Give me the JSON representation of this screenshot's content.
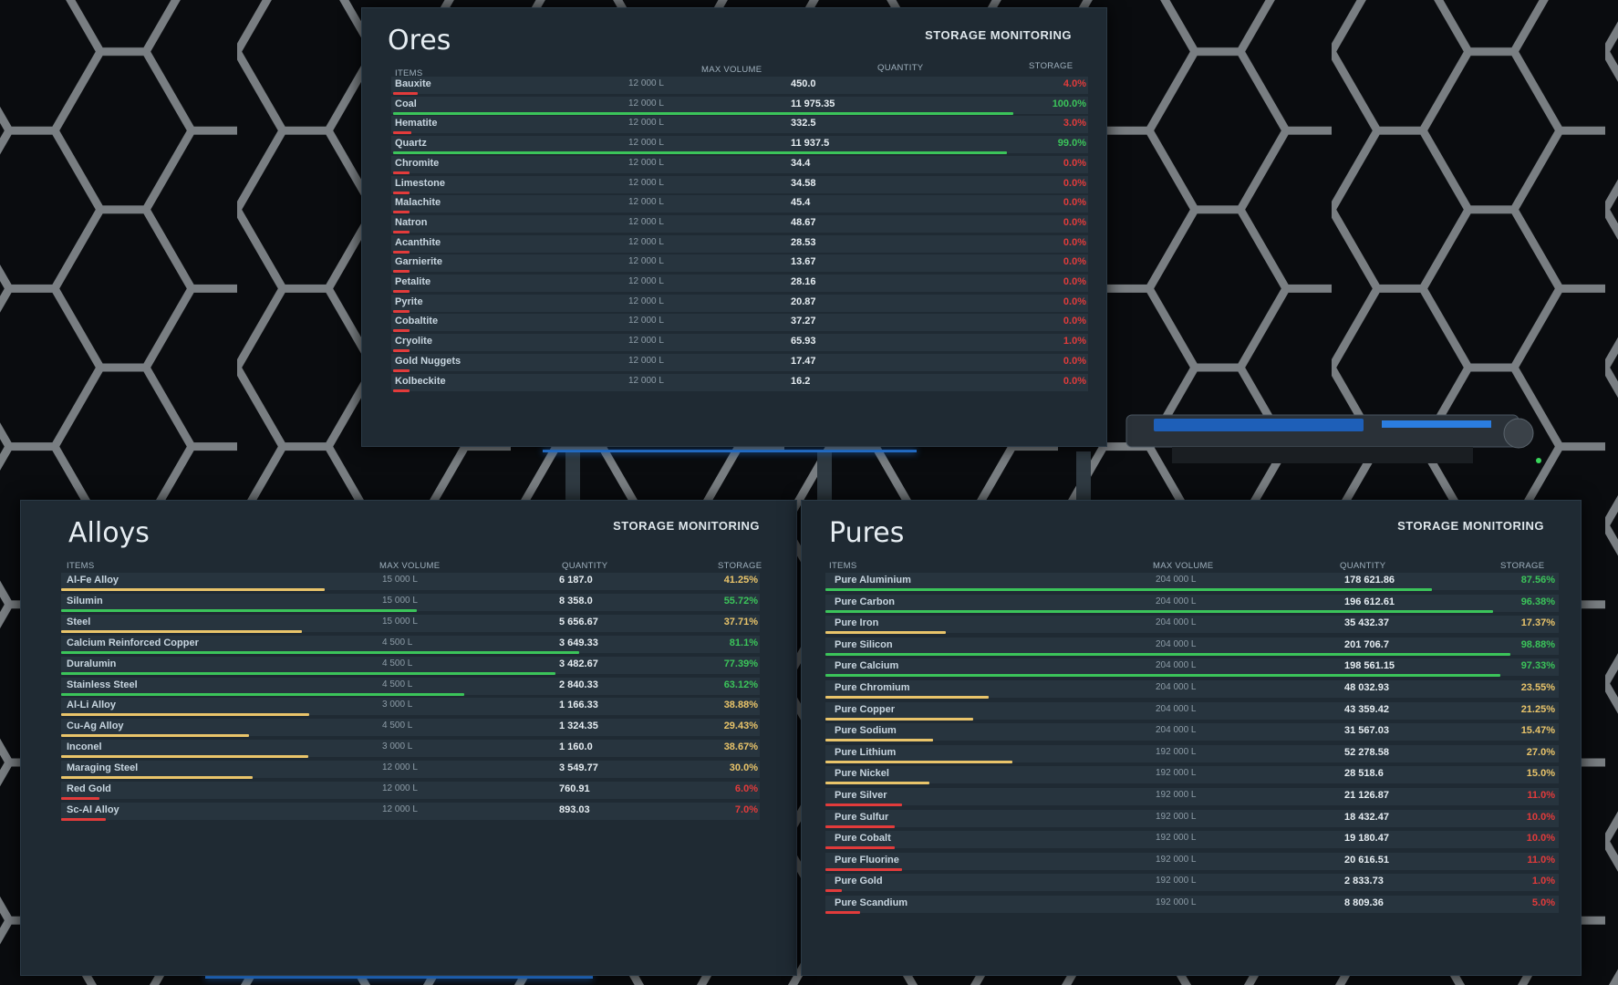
{
  "panels": {
    "ores": {
      "title": "Ores",
      "subtitle": "STORAGE MONITORING",
      "headers": {
        "items": "ITEMS",
        "max_volume": "MAX VOLUME",
        "quantity": "QUANTITY",
        "storage": "STORAGE"
      },
      "rows": [
        {
          "name": "Bauxite",
          "max": "12 000 L",
          "qty": "450.0",
          "pct": "4.0%",
          "fill": 0.04
        },
        {
          "name": "Coal",
          "max": "12 000 L",
          "qty": "11 975.35",
          "pct": "100.0%",
          "fill": 1.0
        },
        {
          "name": "Hematite",
          "max": "12 000 L",
          "qty": "332.5",
          "pct": "3.0%",
          "fill": 0.03
        },
        {
          "name": "Quartz",
          "max": "12 000 L",
          "qty": "11 937.5",
          "pct": "99.0%",
          "fill": 0.99
        },
        {
          "name": "Chromite",
          "max": "12 000 L",
          "qty": "34.4",
          "pct": "0.0%",
          "fill": 0
        },
        {
          "name": "Limestone",
          "max": "12 000 L",
          "qty": "34.58",
          "pct": "0.0%",
          "fill": 0
        },
        {
          "name": "Malachite",
          "max": "12 000 L",
          "qty": "45.4",
          "pct": "0.0%",
          "fill": 0
        },
        {
          "name": "Natron",
          "max": "12 000 L",
          "qty": "48.67",
          "pct": "0.0%",
          "fill": 0
        },
        {
          "name": "Acanthite",
          "max": "12 000 L",
          "qty": "28.53",
          "pct": "0.0%",
          "fill": 0
        },
        {
          "name": "Garnierite",
          "max": "12 000 L",
          "qty": "13.67",
          "pct": "0.0%",
          "fill": 0
        },
        {
          "name": "Petalite",
          "max": "12 000 L",
          "qty": "28.16",
          "pct": "0.0%",
          "fill": 0
        },
        {
          "name": "Pyrite",
          "max": "12 000 L",
          "qty": "20.87",
          "pct": "0.0%",
          "fill": 0
        },
        {
          "name": "Cobaltite",
          "max": "12 000 L",
          "qty": "37.27",
          "pct": "0.0%",
          "fill": 0
        },
        {
          "name": "Cryolite",
          "max": "12 000 L",
          "qty": "65.93",
          "pct": "1.0%",
          "fill": 0.01
        },
        {
          "name": "Gold Nuggets",
          "max": "12 000 L",
          "qty": "17.47",
          "pct": "0.0%",
          "fill": 0
        },
        {
          "name": "Kolbeckite",
          "max": "12 000 L",
          "qty": "16.2",
          "pct": "0.0%",
          "fill": 0
        }
      ]
    },
    "alloys": {
      "title": "Alloys",
      "subtitle": "STORAGE MONITORING",
      "headers": {
        "items": "ITEMS",
        "max_volume": "MAX VOLUME",
        "quantity": "QUANTITY",
        "storage": "STORAGE"
      },
      "rows": [
        {
          "name": "Al-Fe Alloy",
          "max": "15 000 L",
          "qty": "6 187.0",
          "pct": "41.25%",
          "fill": 0.4125
        },
        {
          "name": "Silumin",
          "max": "15 000 L",
          "qty": "8 358.0",
          "pct": "55.72%",
          "fill": 0.5572
        },
        {
          "name": "Steel",
          "max": "15 000 L",
          "qty": "5 656.67",
          "pct": "37.71%",
          "fill": 0.3771
        },
        {
          "name": "Calcium Reinforced Copper",
          "max": "4 500 L",
          "qty": "3 649.33",
          "pct": "81.1%",
          "fill": 0.811
        },
        {
          "name": "Duralumin",
          "max": "4 500 L",
          "qty": "3 482.67",
          "pct": "77.39%",
          "fill": 0.7739
        },
        {
          "name": "Stainless Steel",
          "max": "4 500 L",
          "qty": "2 840.33",
          "pct": "63.12%",
          "fill": 0.6312
        },
        {
          "name": "Al-Li Alloy",
          "max": "3 000 L",
          "qty": "1 166.33",
          "pct": "38.88%",
          "fill": 0.3888
        },
        {
          "name": "Cu-Ag Alloy",
          "max": "4 500 L",
          "qty": "1 324.35",
          "pct": "29.43%",
          "fill": 0.2943
        },
        {
          "name": "Inconel",
          "max": "3 000 L",
          "qty": "1 160.0",
          "pct": "38.67%",
          "fill": 0.3867
        },
        {
          "name": "Maraging Steel",
          "max": "12 000 L",
          "qty": "3 549.77",
          "pct": "30.0%",
          "fill": 0.3
        },
        {
          "name": "Red Gold",
          "max": "12 000 L",
          "qty": "760.91",
          "pct": "6.0%",
          "fill": 0.06
        },
        {
          "name": "Sc-Al Alloy",
          "max": "12 000 L",
          "qty": "893.03",
          "pct": "7.0%",
          "fill": 0.07
        }
      ]
    },
    "pures": {
      "title": "Pures",
      "subtitle": "STORAGE MONITORING",
      "headers": {
        "items": "ITEMS",
        "max_volume": "MAX VOLUME",
        "quantity": "QUANTITY",
        "storage": "STORAGE"
      },
      "rows": [
        {
          "name": "Pure Aluminium",
          "max": "204 000 L",
          "qty": "178 621.86",
          "pct": "87.56%",
          "fill": 0.8756
        },
        {
          "name": "Pure Carbon",
          "max": "204 000 L",
          "qty": "196 612.61",
          "pct": "96.38%",
          "fill": 0.9638
        },
        {
          "name": "Pure Iron",
          "max": "204 000 L",
          "qty": "35 432.37",
          "pct": "17.37%",
          "fill": 0.1737
        },
        {
          "name": "Pure Silicon",
          "max": "204 000 L",
          "qty": "201 706.7",
          "pct": "98.88%",
          "fill": 0.9888
        },
        {
          "name": "Pure Calcium",
          "max": "204 000 L",
          "qty": "198 561.15",
          "pct": "97.33%",
          "fill": 0.9733
        },
        {
          "name": "Pure Chromium",
          "max": "204 000 L",
          "qty": "48 032.93",
          "pct": "23.55%",
          "fill": 0.2355
        },
        {
          "name": "Pure Copper",
          "max": "204 000 L",
          "qty": "43 359.42",
          "pct": "21.25%",
          "fill": 0.2125
        },
        {
          "name": "Pure Sodium",
          "max": "204 000 L",
          "qty": "31 567.03",
          "pct": "15.47%",
          "fill": 0.1547
        },
        {
          "name": "Pure Lithium",
          "max": "192 000 L",
          "qty": "52 278.58",
          "pct": "27.0%",
          "fill": 0.27
        },
        {
          "name": "Pure Nickel",
          "max": "192 000 L",
          "qty": "28 518.6",
          "pct": "15.0%",
          "fill": 0.15
        },
        {
          "name": "Pure Silver",
          "max": "192 000 L",
          "qty": "21 126.87",
          "pct": "11.0%",
          "fill": 0.11
        },
        {
          "name": "Pure Sulfur",
          "max": "192 000 L",
          "qty": "18 432.47",
          "pct": "10.0%",
          "fill": 0.1
        },
        {
          "name": "Pure Cobalt",
          "max": "192 000 L",
          "qty": "19 180.47",
          "pct": "10.0%",
          "fill": 0.1
        },
        {
          "name": "Pure Fluorine",
          "max": "192 000 L",
          "qty": "20 616.51",
          "pct": "11.0%",
          "fill": 0.11
        },
        {
          "name": "Pure Gold",
          "max": "192 000 L",
          "qty": "2 833.73",
          "pct": "1.0%",
          "fill": 0.01
        },
        {
          "name": "Pure Scandium",
          "max": "192 000 L",
          "qty": "8 809.36",
          "pct": "5.0%",
          "fill": 0.05
        }
      ]
    }
  },
  "colors": {
    "green": "#3bc45a",
    "yellow": "#e9c46a",
    "red": "#e23b3b",
    "panel": "#1f2a33",
    "hex_line": "#8c9296",
    "glow": "#2d8cff"
  }
}
